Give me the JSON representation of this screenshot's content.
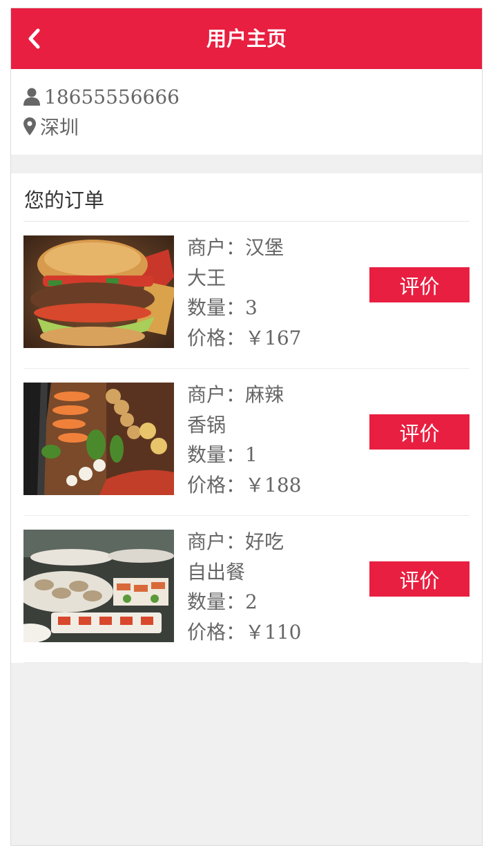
{
  "header": {
    "title": "用户主页",
    "back_icon": "chevron-left-icon"
  },
  "profile": {
    "phone": "18655556666",
    "phone_icon": "user-icon",
    "city": "深圳",
    "city_icon": "map-marker-icon"
  },
  "orders": {
    "title": "您的订单",
    "items": [
      {
        "image": "burger-photo",
        "merchant_label": "商户：",
        "merchant_line1": "汉堡",
        "merchant_line2": "大王",
        "quantity": "数量：3",
        "price": "价格：￥167",
        "rate_label": "评价"
      },
      {
        "image": "skewers-hotpot-photo",
        "merchant_label": "商户：",
        "merchant_line1": "麻辣",
        "merchant_line2": "香锅",
        "quantity": "数量：1",
        "price": "价格：￥188",
        "rate_label": "评价"
      },
      {
        "image": "buffet-photo",
        "merchant_label": "商户：",
        "merchant_line1": "好吃",
        "merchant_line2": "自出餐",
        "quantity": "数量：2",
        "price": "价格：￥110",
        "rate_label": "评价"
      }
    ]
  },
  "colors": {
    "brand": "#e81f41",
    "text": "#666666",
    "background": "#f0f0f0"
  }
}
